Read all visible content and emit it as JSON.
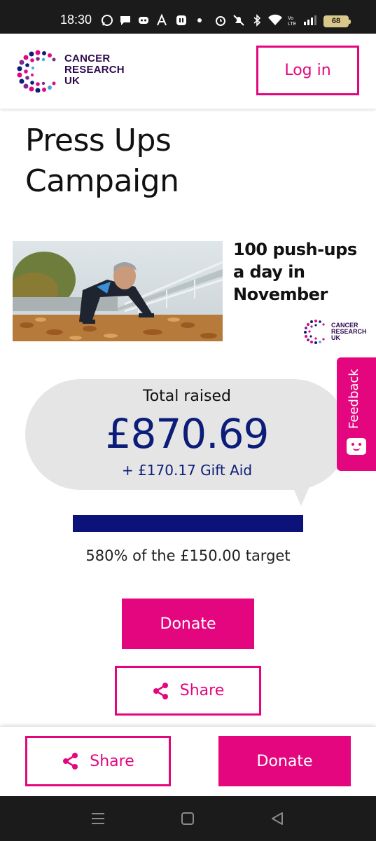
{
  "status_bar": {
    "time": "18:30",
    "battery": "68",
    "icons": [
      "whatsapp-icon",
      "chat-icon",
      "discord-icon",
      "a-icon",
      "app-icon",
      "dot-icon",
      "alarm-icon",
      "mute-icon",
      "bluetooth-icon",
      "wifi-icon",
      "volte-icon",
      "signal-icon",
      "battery-icon"
    ]
  },
  "header": {
    "logo_text": [
      "CANCER",
      "RESEARCH",
      "UK"
    ],
    "login_label": "Log in"
  },
  "page": {
    "title": "Press Ups Campaign",
    "hero_text": "100 push-ups a day in November",
    "hero_logo_text": [
      "CANCER",
      "RESEARCH",
      "UK"
    ]
  },
  "fundraising": {
    "total_label": "Total raised",
    "total_amount": "£870.69",
    "gift_aid": "+ £170.17 Gift Aid",
    "target_text": "580% of the £150.00 target",
    "progress_fraction": 1.0
  },
  "actions": {
    "donate_label": "Donate",
    "share_label": "Share"
  },
  "sticky_bar": {
    "share_label": "Share",
    "donate_label": "Donate"
  },
  "feedback": {
    "label": "Feedback"
  },
  "colors": {
    "brand_pink": "#e4067e",
    "navy": "#0b1d78",
    "bubble_grey": "#e5e5e5"
  },
  "nav_bar": {
    "icons": [
      "menu-icon",
      "home-icon",
      "back-icon"
    ]
  }
}
